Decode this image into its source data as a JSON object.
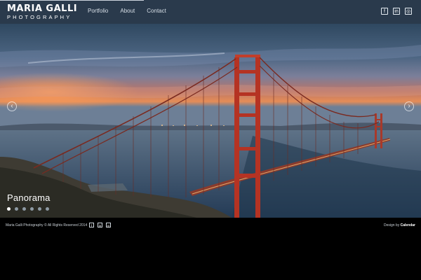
{
  "brand": {
    "name": "MARIA GALLI",
    "subtitle": "PHOTOGRAPHY"
  },
  "nav": {
    "items": [
      "Portfolio",
      "About",
      "Contact"
    ]
  },
  "social": {
    "icons": [
      "f",
      "in",
      "◎"
    ]
  },
  "hero": {
    "caption": "Panorama",
    "prev_label": "‹",
    "next_label": "›",
    "dots_count": 6,
    "active_dot": 0
  },
  "footer": {
    "copyright": "Maria Galli Photography © All Rights Reserved 2014",
    "design_prefix": "Design by",
    "design_by": "Calendar"
  },
  "colors": {
    "header": "#2a3a4c",
    "bridge": "#b53323",
    "sky_glow": "#f29a5a"
  }
}
